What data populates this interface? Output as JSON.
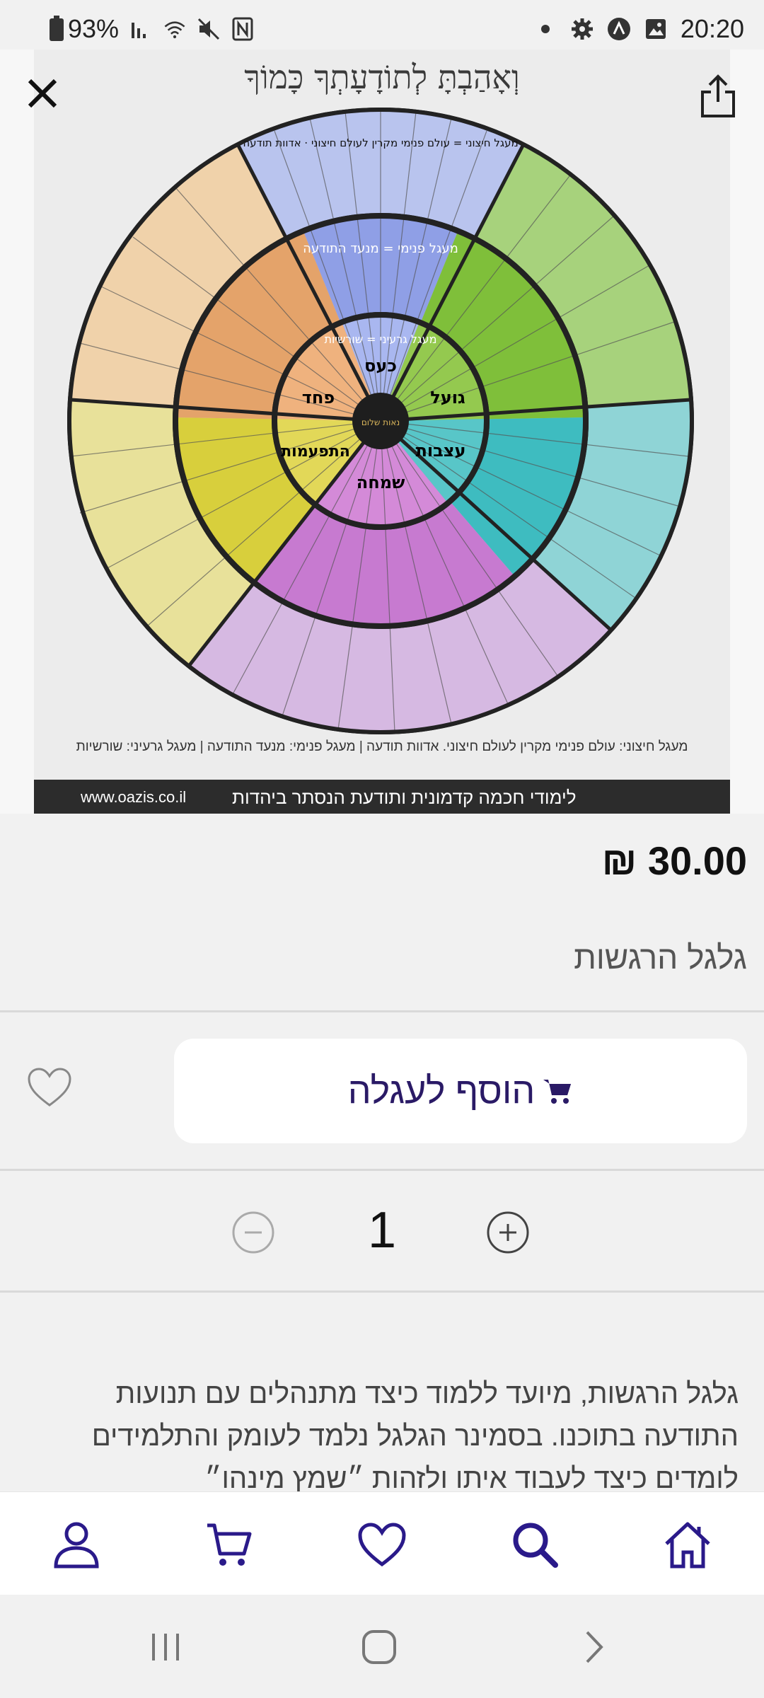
{
  "status_bar": {
    "battery": "93%",
    "time": "20:20",
    "icons": [
      "battery-icon",
      "signal-icon",
      "wifi-icon",
      "mute-icon",
      "nfc-icon",
      "dot-icon",
      "gear-icon",
      "notification-icon",
      "image-icon"
    ]
  },
  "image": {
    "title": "וְאָהַבְתָּ לְתוֹדָעָתְךָ כָּמוֹךָ",
    "wheel": {
      "center_logo": "נאות שלום",
      "inner_labels": [
        "כעס",
        "גועל",
        "עצבות",
        "שמחה",
        "התפעמות",
        "פחד"
      ],
      "ring_labels": [
        "מעגל גרעיני = שורשיות",
        "מעגל פנימי = מנעד התודעה",
        "מעגל חיצוני = עולם פנימי מקרין לעולם חיצוני ⋅ אדוות תודעה"
      ]
    },
    "legend": "מעגל חיצוני: עולם פנימי מקרין לעולם חיצוני. אדוות תודעה | מעגל פנימי: מנעד התודעה | מעגל גרעיני: שורשיות",
    "footer_url": "www.oazis.co.il",
    "footer_slogan": "לימודי חכמה קדמונית ותודעת הנסתר ביהדות"
  },
  "product": {
    "price": "30.00 ₪",
    "title": "גלגל הרגשות",
    "add_to_cart_label": "הוסף לעגלה",
    "quantity": "1",
    "description": "גלגל הרגשות, מיועד ללמוד כיצד מתנהלים עם תנועות התודעה בתוכנו. בסמינר הגלגל נלמד לעומק והתלמידים לומדים כיצד לעבוד איתו ולזהות ״שמץ מינהו״"
  },
  "colors": {
    "accent": "#2a1a66",
    "nav_icon": "#2a1a8a"
  },
  "nav": [
    "user-icon",
    "cart-icon",
    "heart-icon",
    "search-icon",
    "home-icon"
  ]
}
